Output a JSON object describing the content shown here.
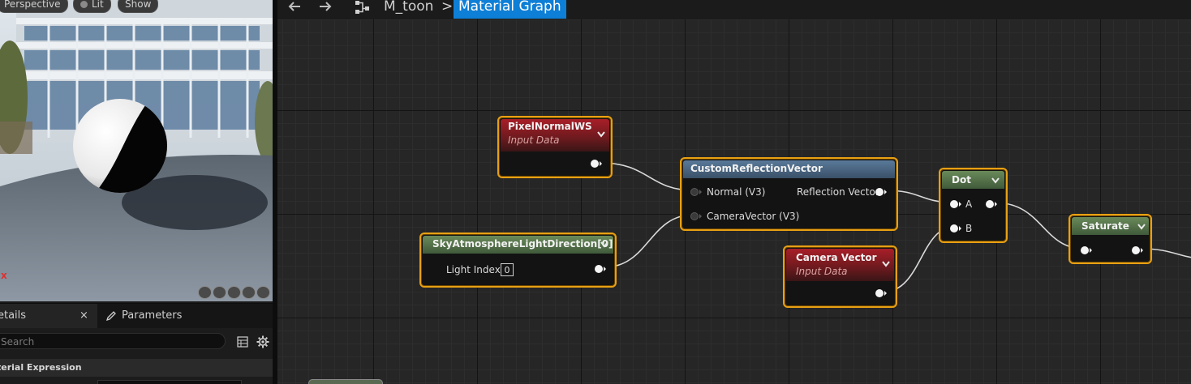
{
  "viewport": {
    "perspective_label": "Perspective",
    "lit_label": "Lit",
    "show_label": "Show",
    "axis_label": "x"
  },
  "details": {
    "tab_details_label": "etails",
    "tab_close_label": "×",
    "tab_parameters_label": "Parameters",
    "search_placeholder": "Search",
    "category_header": "terial Expression"
  },
  "breadcrumb": {
    "asset_name": "M_toon",
    "separator": ">",
    "current": "Material Graph"
  },
  "nodes": {
    "pixel_normal": {
      "title": "PixelNormalWS",
      "subtitle": "Input Data"
    },
    "custom_reflection": {
      "title": "CustomReflectionVector",
      "input_normal": "Normal (V3)",
      "input_camera": "CameraVector (V3)",
      "output": "Reflection Vector"
    },
    "sky_light": {
      "title": "SkyAtmosphereLightDirection[0]",
      "light_index_label": "Light Index",
      "light_index_value": "0"
    },
    "camera_vector": {
      "title": "Camera Vector",
      "subtitle": "Input Data"
    },
    "dot": {
      "title": "Dot",
      "input_a": "A",
      "input_b": "B"
    },
    "saturate": {
      "title": "Saturate"
    }
  },
  "colors": {
    "selection_outline": "#e8a013",
    "breadcrumb_highlight": "#0e7fd6",
    "input_data_header": "#a81e28",
    "custom_header": "#5a7a9a",
    "math_header": "#6a8a5a"
  }
}
